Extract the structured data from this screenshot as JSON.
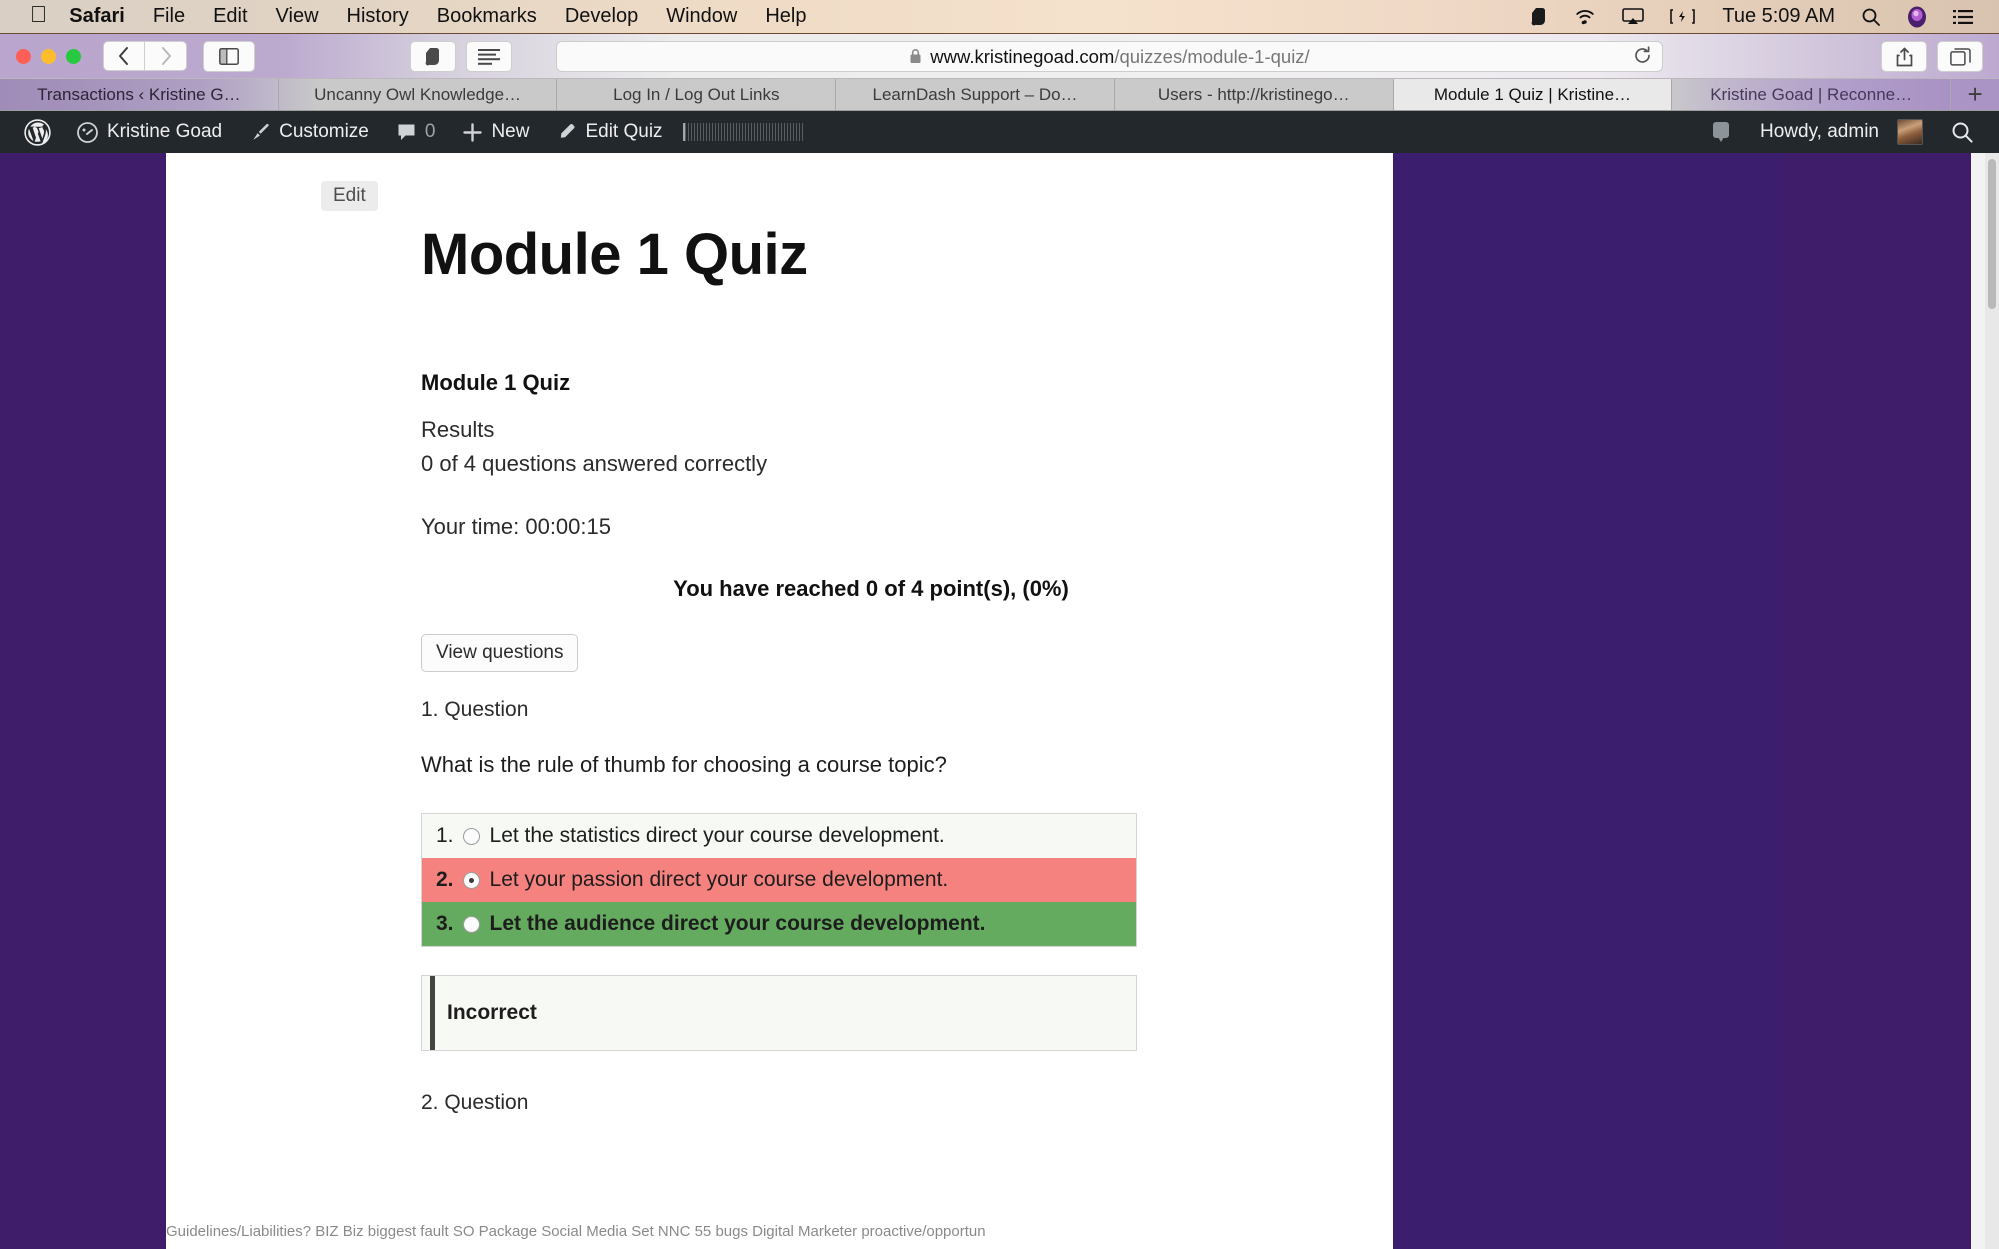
{
  "menubar": {
    "apple_icon": "apple-icon",
    "items": [
      {
        "label": "Safari",
        "bold": true
      },
      {
        "label": "File",
        "bold": false
      },
      {
        "label": "Edit",
        "bold": false
      },
      {
        "label": "View",
        "bold": false
      },
      {
        "label": "History",
        "bold": false
      },
      {
        "label": "Bookmarks",
        "bold": false
      },
      {
        "label": "Develop",
        "bold": false
      },
      {
        "label": "Window",
        "bold": false
      },
      {
        "label": "Help",
        "bold": false
      }
    ],
    "status": {
      "evernote_icon": "evernote-icon",
      "wifi_icon": "wifi-icon",
      "airplay_icon": "airplay-icon",
      "battery_icon": "battery-charging-icon",
      "clock": "Tue 5:09 AM",
      "search_icon": "spotlight-search-icon",
      "siri_icon": "siri-icon",
      "notification_icon": "notification-center-icon"
    }
  },
  "toolbar": {
    "back_icon": "chevron-left-icon",
    "forward_icon": "chevron-right-icon",
    "sidebar_icon": "sidebar-toggle-icon",
    "evernote_icon": "evernote-clipper-icon",
    "reader_icon": "reader-view-icon",
    "share_icon": "share-icon",
    "tabs_icon": "show-all-tabs-icon",
    "reload_icon": "reload-icon",
    "lock_icon": "lock-icon",
    "url_host": "www.kristinegoad.com",
    "url_path": "/quizzes/module-1-quiz/",
    "url_full": "www.kristinegoad.com/quizzes/module-1-quiz/"
  },
  "tabs": {
    "items": [
      {
        "label": "Transactions ‹ Kristine G…",
        "active": false,
        "tint": "left"
      },
      {
        "label": "Uncanny Owl Knowledge…",
        "active": false,
        "tint": "none"
      },
      {
        "label": "Log In / Log Out Links",
        "active": false,
        "tint": "none"
      },
      {
        "label": "LearnDash Support – Do…",
        "active": false,
        "tint": "none"
      },
      {
        "label": "Users - http://kristinego…",
        "active": false,
        "tint": "none"
      },
      {
        "label": "Module 1 Quiz | Kristine…",
        "active": true,
        "tint": "none"
      },
      {
        "label": "Kristine Goad | Reconne…",
        "active": false,
        "tint": "right"
      }
    ],
    "new_tab_label": "+"
  },
  "adminbar": {
    "wp_logo_icon": "wordpress-logo-icon",
    "site_icon": "dashboard-icon",
    "site_name": "Kristine Goad",
    "customize_icon": "paintbrush-icon",
    "customize_label": "Customize",
    "comments_icon": "comment-bubble-icon",
    "comments_count": "0",
    "new_icon": "plus-icon",
    "new_label": "New",
    "edit_icon": "pencil-icon",
    "edit_label": "Edit Quiz",
    "notification_icon": "comment-bubble-icon",
    "howdy_label": "Howdy, admin",
    "avatar": "user-avatar",
    "search_icon": "search-icon"
  },
  "page": {
    "edit_button": "Edit",
    "title": "Module 1 Quiz",
    "quiz_name": "Module 1 Quiz",
    "results_label": "Results",
    "results_summary": "0 of 4 questions answered correctly",
    "your_time": "Your time: 00:00:15",
    "points_reached": "You have reached 0 of 4 point(s), (0%)",
    "view_questions_button": "View questions",
    "question": {
      "number_label": "1. Question",
      "text": "What is the rule of thumb for choosing a course topic?",
      "answers": [
        {
          "index": "1.",
          "text": "Let the statistics direct your course development.",
          "state": "neutral",
          "selected": false
        },
        {
          "index": "2.",
          "text": "Let your passion direct your course development.",
          "state": "wrong",
          "selected": true
        },
        {
          "index": "3.",
          "text": "Let the audience direct your course development.",
          "state": "correct",
          "selected": false
        }
      ],
      "feedback": "Incorrect"
    },
    "next_question_label": "2. Question",
    "background_strip": "Guidelines/Liabilities?   BIZ Biz biggest fault    SO Package Social Media Set     NNC 55 bugs              Digital Marketer        proactive/opportun"
  },
  "colors": {
    "accent_purple": "#3f1d6b",
    "admin_dark": "#23282d",
    "wrong_red": "#f5827f",
    "correct_green": "#64aa5f",
    "answer_bg": "#f7f9f4"
  }
}
